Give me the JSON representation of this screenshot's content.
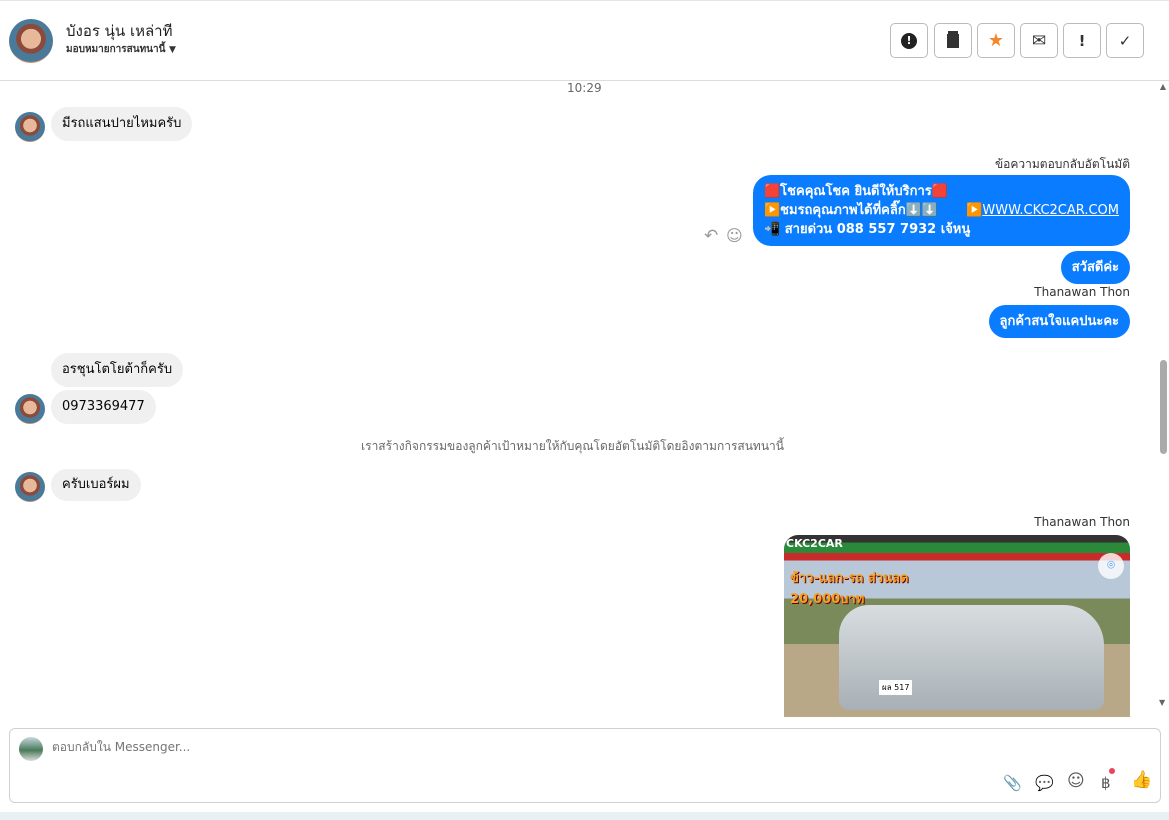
{
  "header": {
    "name": "บังอร นุ่น เหล่าที",
    "assign": "มอบหมายการสนทนานี้",
    "actions": [
      {
        "icon": "alert-circle-icon",
        "glyph": "⬤"
      },
      {
        "icon": "trash-icon",
        "glyph": "🗑"
      },
      {
        "icon": "star-icon",
        "glyph": "★"
      },
      {
        "icon": "envelope-icon",
        "glyph": "✉"
      },
      {
        "icon": "exclamation-icon",
        "glyph": "!"
      },
      {
        "icon": "check-icon",
        "glyph": "✓"
      }
    ]
  },
  "chat": {
    "time": "10:29",
    "m1": "มีรถแสนปายไหมครับ",
    "auto_label": "ข้อความตอบกลับอัตโนมัติ",
    "auto_lines": [
      "🟥โชคคุณโชค ยินดีให้บริการ🟥",
      "▶️ชมรถคุณภาพได้ที่คลิ๊ก⬇️⬇️",
      "📲 สายด่วน 088 557 7932 เจ้หนู"
    ],
    "auto_link": "WWW.CKC2CAR.COM",
    "m2": "สวัสดีค่ะ",
    "sender": "Thanawan Thon",
    "m3": "ลูกค้าสนใจแคปนะคะ",
    "m4": "อรชุนโตโยต้าก็ครับ",
    "m5": "0973369477",
    "system": "เราสร้างกิจกรรมของลูกค้าเป้าหมายให้กับคุณโดยอัตโนมัติโดยอิงตามการสนทนานี้",
    "m6": "ครับเบอร์ผม",
    "sender2": "Thanawan Thon",
    "image_banner": "CKC2CAR",
    "image_promo": "ข้าว-แลก-รถ ส่วนลด 20,000บาท",
    "image_plate": "ผล 517"
  },
  "composer": {
    "placeholder": "ตอบกลับใน Messenger..."
  },
  "colors": {
    "accent": "#0a7cff",
    "star": "#f5862a"
  }
}
